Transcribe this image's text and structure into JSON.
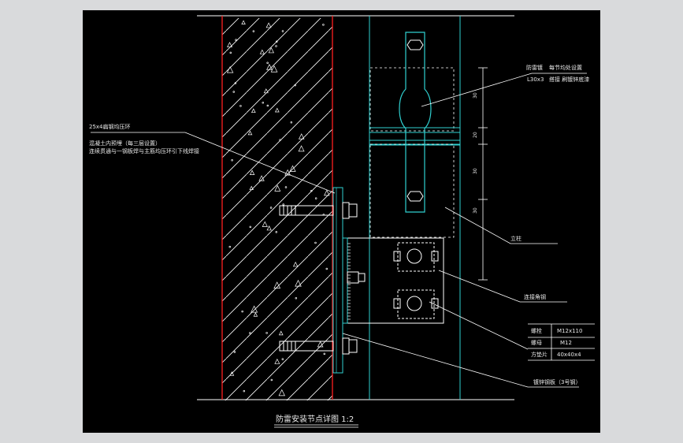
{
  "drawing": {
    "title": "防雷安装节点详图 1:2",
    "colors": {
      "background": "#000000",
      "frame": "#d9dadc",
      "wall_edge": "#ff2020",
      "steel": "#30d0d0",
      "lines": "#ffffff",
      "text": "#e8e8e8"
    },
    "labels": {
      "top_right_1a": "防雷镀",
      "top_right_1b": "每节均处设置",
      "top_right_2a": "L30x3",
      "top_right_2b": "搭接 刷镀锌底漆",
      "left_1": "25x4扁钢均压环",
      "left_2": "混凝土内预埋（每三层设置）",
      "left_3": "连续贯通与一钢板焊与主筋均压环引下线焊接",
      "right_column": "立柱",
      "right_angle": "连接角钢",
      "bottom_right": "镀锌钢板（3号钢）"
    },
    "table": [
      {
        "name": "螺栓",
        "spec": "M12x110"
      },
      {
        "name": "螺母",
        "spec": "M12"
      },
      {
        "name": "方垫片",
        "spec": "40x40x4"
      }
    ],
    "dimensions": [
      "30",
      "20",
      "30",
      "30"
    ]
  }
}
